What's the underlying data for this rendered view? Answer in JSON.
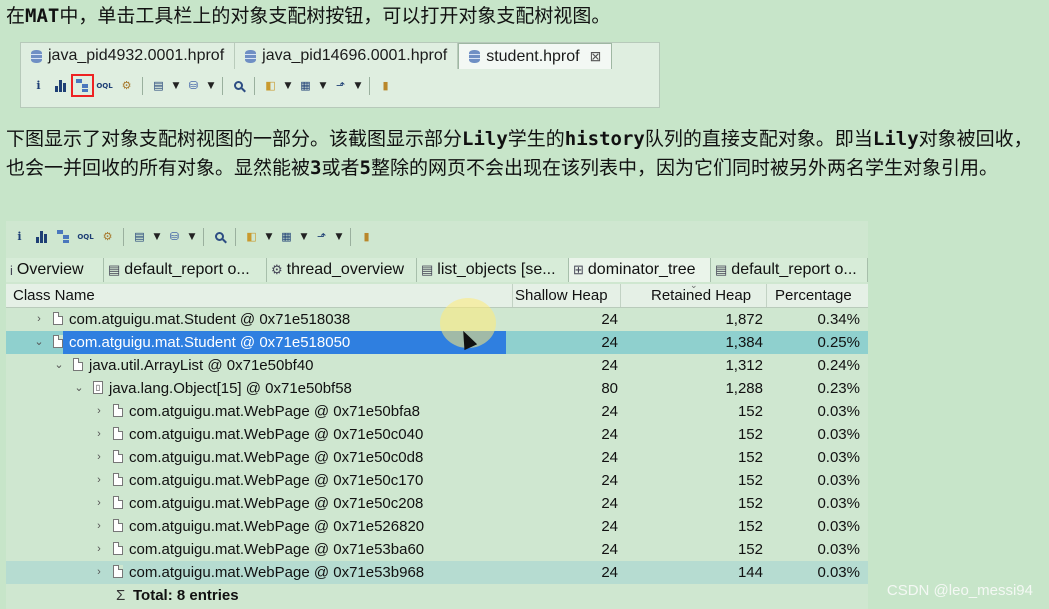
{
  "intro_text_parts": [
    "在",
    "MAT",
    "中，单击工具栏上的对象支配树按钮，可以打开对象支配树视图。"
  ],
  "desc_text_parts": [
    "下图显示了对象支配树视图的一部分。该截图显示部分",
    "Lily",
    "学生的",
    "history",
    "队列的直接支配对象。即当",
    "Lily",
    "对象被回收，也会一并回收的所有对象。显然能被",
    "3",
    "或者",
    "5",
    "整除的网页不会出现在该列表中，因为它们同时被另外两名学生对象引用。"
  ],
  "editor_tabs": [
    {
      "label": "java_pid4932.0001.hprof",
      "active": false
    },
    {
      "label": "java_pid14696.0001.hprof",
      "active": false
    },
    {
      "label": "student.hprof",
      "active": true,
      "close": "⊠"
    }
  ],
  "toolbar": {
    "info_glyph": "i",
    "oql_glyph": "OQL",
    "selected_button": "dominator-tree-button"
  },
  "view_tabs": [
    {
      "label": "Overview",
      "icon": "i"
    },
    {
      "label": "default_report  o...",
      "icon": "▤"
    },
    {
      "label": "thread_overview",
      "icon": "⚙"
    },
    {
      "label": "list_objects  [se...",
      "icon": "▤"
    },
    {
      "label": "dominator_tree",
      "icon": "⊞"
    },
    {
      "label": "default_report  o...",
      "icon": "▤"
    }
  ],
  "table": {
    "headers": {
      "class_name": "Class Name",
      "shallow_heap": "Shallow Heap",
      "retained_heap": "Retained Heap",
      "percentage": "Percentage"
    },
    "rows": [
      {
        "indent": 0,
        "twisty": "›",
        "icon": "file",
        "name": "com.atguigu.mat.Student @ 0x71e518038",
        "shallow": "24",
        "retained": "1,872",
        "pct": "0.34%"
      },
      {
        "indent": 0,
        "twisty": "⌄",
        "icon": "file",
        "name": "com.atguigu.mat.Student @ 0x71e518050",
        "shallow": "24",
        "retained": "1,384",
        "pct": "0.25%",
        "selected": true
      },
      {
        "indent": 1,
        "twisty": "⌄",
        "icon": "file",
        "name": "java.util.ArrayList @ 0x71e50bf40",
        "shallow": "24",
        "retained": "1,312",
        "pct": "0.24%"
      },
      {
        "indent": 2,
        "twisty": "⌄",
        "icon": "array",
        "name": "java.lang.Object[15] @ 0x71e50bf58",
        "shallow": "80",
        "retained": "1,288",
        "pct": "0.23%"
      },
      {
        "indent": 3,
        "twisty": "›",
        "icon": "file",
        "name": "com.atguigu.mat.WebPage @ 0x71e50bfa8",
        "shallow": "24",
        "retained": "152",
        "pct": "0.03%"
      },
      {
        "indent": 3,
        "twisty": "›",
        "icon": "file",
        "name": "com.atguigu.mat.WebPage @ 0x71e50c040",
        "shallow": "24",
        "retained": "152",
        "pct": "0.03%"
      },
      {
        "indent": 3,
        "twisty": "›",
        "icon": "file",
        "name": "com.atguigu.mat.WebPage @ 0x71e50c0d8",
        "shallow": "24",
        "retained": "152",
        "pct": "0.03%"
      },
      {
        "indent": 3,
        "twisty": "›",
        "icon": "file",
        "name": "com.atguigu.mat.WebPage @ 0x71e50c170",
        "shallow": "24",
        "retained": "152",
        "pct": "0.03%"
      },
      {
        "indent": 3,
        "twisty": "›",
        "icon": "file",
        "name": "com.atguigu.mat.WebPage @ 0x71e50c208",
        "shallow": "24",
        "retained": "152",
        "pct": "0.03%"
      },
      {
        "indent": 3,
        "twisty": "›",
        "icon": "file",
        "name": "com.atguigu.mat.WebPage @ 0x71e526820",
        "shallow": "24",
        "retained": "152",
        "pct": "0.03%"
      },
      {
        "indent": 3,
        "twisty": "›",
        "icon": "file",
        "name": "com.atguigu.mat.WebPage @ 0x71e53ba60",
        "shallow": "24",
        "retained": "152",
        "pct": "0.03%"
      },
      {
        "indent": 3,
        "twisty": "›",
        "icon": "file",
        "name": "com.atguigu.mat.WebPage @ 0x71e53b968",
        "shallow": "24",
        "retained": "144",
        "pct": "0.03%"
      }
    ],
    "total": {
      "glyph": "Σ",
      "label": "Total: 8 entries"
    }
  },
  "watermark": "CSDN @leo_messi94",
  "colors": {
    "page_bg": "#c7e5c9",
    "selection": "#2f7fe0",
    "toolbar_highlight": "#e22222"
  }
}
